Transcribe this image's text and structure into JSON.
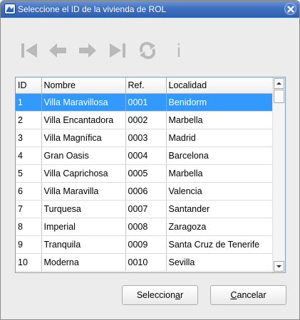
{
  "window": {
    "title": "Seleccione el ID de la vivienda de ROL"
  },
  "toolbar": {
    "info_label": "i"
  },
  "table": {
    "columns": [
      "ID",
      "Nombre",
      "Ref.",
      "Localidad"
    ],
    "selected_row": 0,
    "rows": [
      [
        "1",
        "Villa Maravillosa",
        "0001",
        "Benidorm"
      ],
      [
        "2",
        "Villa Encantadora",
        "0002",
        "Marbella"
      ],
      [
        "3",
        "Villa Magnífica",
        "0003",
        "Madrid"
      ],
      [
        "4",
        "Gran Oasis",
        "0004",
        "Barcelona"
      ],
      [
        "5",
        "Villa Caprichosa",
        "0005",
        "Marbella"
      ],
      [
        "6",
        "Villa Maravilla",
        "0006",
        "Valencia"
      ],
      [
        "7",
        "Turquesa",
        "0007",
        "Santander"
      ],
      [
        "8",
        "Imperial",
        "0008",
        "Zaragoza"
      ],
      [
        "9",
        "Tranquila",
        "0009",
        "Santa Cruz de Tenerife"
      ],
      [
        "10",
        "Moderna",
        "0010",
        "Sevilla"
      ]
    ]
  },
  "buttons": {
    "select": {
      "before": "Seleccion",
      "mnemonic": "a",
      "after": "r"
    },
    "cancel": {
      "before": "",
      "mnemonic": "C",
      "after": "ancelar"
    }
  },
  "colors": {
    "titlebar": "#3f6fbe",
    "selection": "#3399ff",
    "disabled_icon": "#b9b9b9"
  },
  "icons": [
    "app-icon",
    "close-icon",
    "first-record-icon",
    "previous-record-icon",
    "next-record-icon",
    "last-record-icon",
    "refresh-icon",
    "info-icon",
    "scroll-up-arrow-icon",
    "scroll-down-arrow-icon"
  ]
}
